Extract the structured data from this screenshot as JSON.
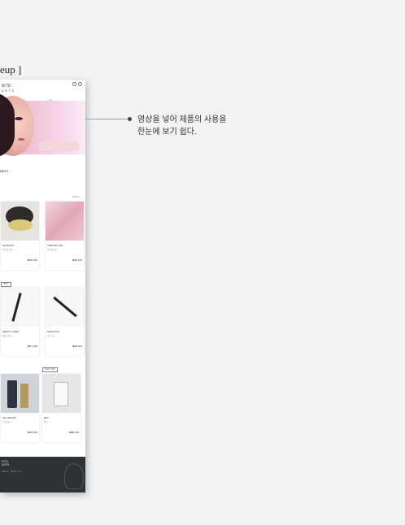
{
  "section_label": "eup ]",
  "phone": {
    "brand": {
      "name": "IETD",
      "sub": "A R T S"
    },
    "top_icons": {
      "text": "··· · ··"
    },
    "tabs": [
      "MAKEUP",
      "스킨"
    ],
    "best_title": "BEST",
    "more_label": "VIEW ▸",
    "products": [
      {
        "title": "UM BALM",
        "desc": "립앤 밤 & 밤 ··· ···· ···",
        "price": "₩33,000",
        "badge": ""
      },
      {
        "title": "PURE BLUSH",
        "desc": "퓨어 블러쉬 ··· ····",
        "price": "₩30,000",
        "badge": ""
      },
      {
        "title": "PENCIL LINER",
        "desc": "펜슬 라이너 ··· ··· ····",
        "price": "₩17,000",
        "badge": "BEST"
      },
      {
        "title": "MASCARA",
        "desc": "마스카라 ··· ····",
        "price": "₩28,000",
        "badge": ""
      },
      {
        "title": "OIL SERUM",
        "desc": "오일 세럼 ··· ····",
        "price": "₩45,000",
        "badge": ""
      },
      {
        "title": "EDT",
        "desc": "퍼퓸 ··· ····",
        "price": "₩98,000",
        "badge": "NEW ITEM"
      }
    ],
    "footer": {
      "brand": "IETD",
      "sub": "ARTS",
      "links": "ABOUT · SHOP · CS · ··· ····"
    }
  },
  "callout": {
    "line1": "영상을 넣어 제품의 사용을",
    "line2": "한눈에 보기 쉽다."
  }
}
